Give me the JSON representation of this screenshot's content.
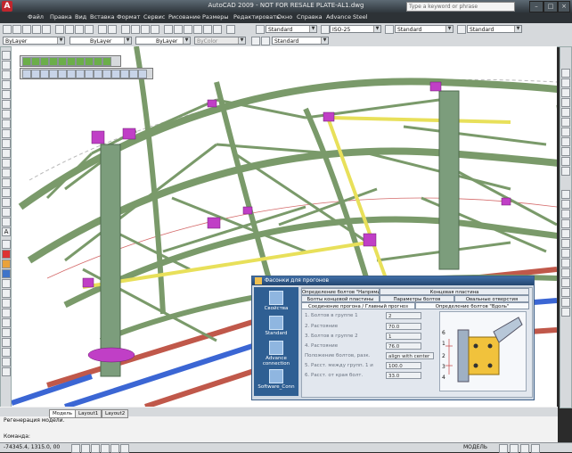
{
  "window": {
    "title": "AutoCAD 2009 - NOT FOR RESALE PLATE-AL1.dwg",
    "search_placeholder": "Type a keyword or phrase"
  },
  "menu": [
    "Файл",
    "Правка",
    "Вид",
    "Вставка",
    "Формат",
    "Сервис",
    "Рисование",
    "Размеры",
    "Редактировать",
    "Окно",
    "Справка",
    "Advance Steel"
  ],
  "toolbar": {
    "layer_combo": "ByLayer",
    "linetype_combo": "ByLayer",
    "lineweight_combo": "ByLayer",
    "color_combo": "ByColor",
    "text_style": "Standard",
    "dim_style": "ISO-25",
    "table_style": "Standard",
    "multileader_style": "Standard",
    "workspace_combo": "Standard"
  },
  "dialog": {
    "title": "Фасонки для прогонов",
    "side_buttons": [
      "Свойства",
      "Standard",
      "Advance connection",
      "Software_Conn"
    ],
    "tabs_row1": [
      "Определение болтов \"Напрями\"",
      "Концевая пластина"
    ],
    "tabs_row2": [
      "Болты концевой пластины",
      "Параметры болтов",
      "Овальные отверстия"
    ],
    "tabs_row3": [
      "Соединение прогона / Главный прогноз",
      "Определение болтов \"Вдоль\""
    ],
    "fields": [
      {
        "label": "1. Болтов в группе 1",
        "value": "2"
      },
      {
        "label": "2. Растояние",
        "value": "70.0"
      },
      {
        "label": "3. Болтов в группе 2",
        "value": "1"
      },
      {
        "label": "4. Растояние",
        "value": "76.0"
      },
      {
        "label": "Положение болтов, разк.",
        "value": "align with center"
      },
      {
        "label": "5. Расст. между групп. 1 и",
        "value": "100.0"
      },
      {
        "label": "6. Расст. от края болт.",
        "value": "33.0"
      }
    ],
    "diagram_labels": [
      "6",
      "1",
      "2",
      "3",
      "4"
    ]
  },
  "layout_tabs": [
    "Модель",
    "Layout1",
    "Layout2"
  ],
  "command": {
    "history": "Регенерация модели.",
    "prompt": "Команда:"
  },
  "status": {
    "coords": "-74345.4, 1315.0, 00",
    "mode": "МОДЕЛЬ"
  },
  "colors": {
    "steel_green": "#7a9a6a",
    "connection_magenta": "#c03fc6",
    "highlight_yellow": "#e8e05a",
    "purlin_red": "#c0584a",
    "purlin_blue": "#3b66d4",
    "dialog_blue": "#2f5f93"
  }
}
